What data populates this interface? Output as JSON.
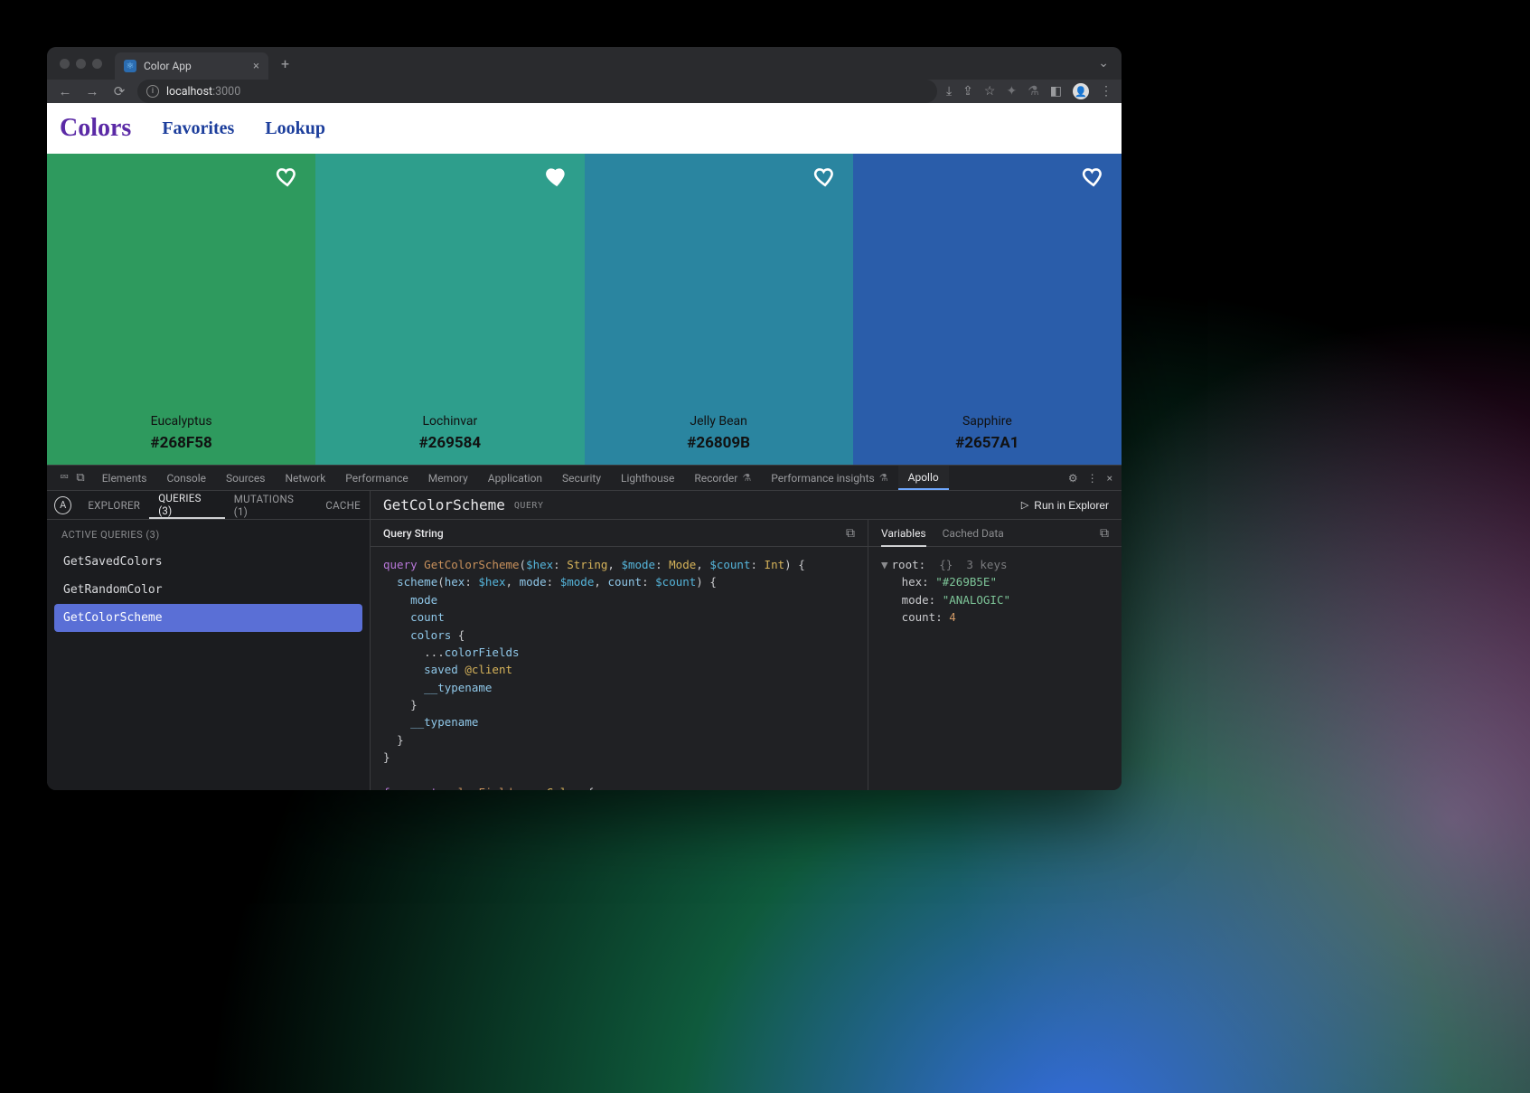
{
  "browser": {
    "tab_title": "Color App",
    "url_host": "localhost",
    "url_path": ":3000"
  },
  "app": {
    "logo": "Colors",
    "nav": {
      "favorites": "Favorites",
      "lookup": "Lookup"
    },
    "swatches": [
      {
        "name": "Eucalyptus",
        "hex": "#268F58",
        "bg": "#2e9a5e",
        "favorited": false
      },
      {
        "name": "Lochinvar",
        "hex": "#269584",
        "bg": "#2e9e8c",
        "favorited": true
      },
      {
        "name": "Jelly Bean",
        "hex": "#26809B",
        "bg": "#2a85a0",
        "favorited": false
      },
      {
        "name": "Sapphire",
        "hex": "#2657A1",
        "bg": "#2a5daa",
        "favorited": false
      }
    ]
  },
  "devtools": {
    "tabs": [
      "Elements",
      "Console",
      "Sources",
      "Network",
      "Performance",
      "Memory",
      "Application",
      "Security",
      "Lighthouse",
      "Recorder",
      "Performance insights",
      "Apollo"
    ],
    "active_tab": "Apollo",
    "flask_tabs": [
      "Recorder",
      "Performance insights"
    ]
  },
  "apollo": {
    "subtabs": {
      "explorer": "EXPLORER",
      "queries": "QUERIES (3)",
      "mutations": "MUTATIONS (1)",
      "cache": "CACHE"
    },
    "active_subtab": "QUERIES (3)",
    "active_section": "ACTIVE QUERIES (3)",
    "queries": [
      "GetSavedColors",
      "GetRandomColor",
      "GetColorScheme"
    ],
    "selected_query": "GetColorScheme",
    "detail": {
      "op_name": "GetColorScheme",
      "op_kind": "QUERY",
      "run_label": "Run in Explorer",
      "query_string_label": "Query String",
      "vars_tabs": {
        "variables": "Variables",
        "cached": "Cached Data"
      },
      "variables": {
        "root_label": "root:",
        "root_meta": "3 keys",
        "hex": "#269B5E",
        "mode": "ANALOGIC",
        "count": 4
      }
    }
  }
}
